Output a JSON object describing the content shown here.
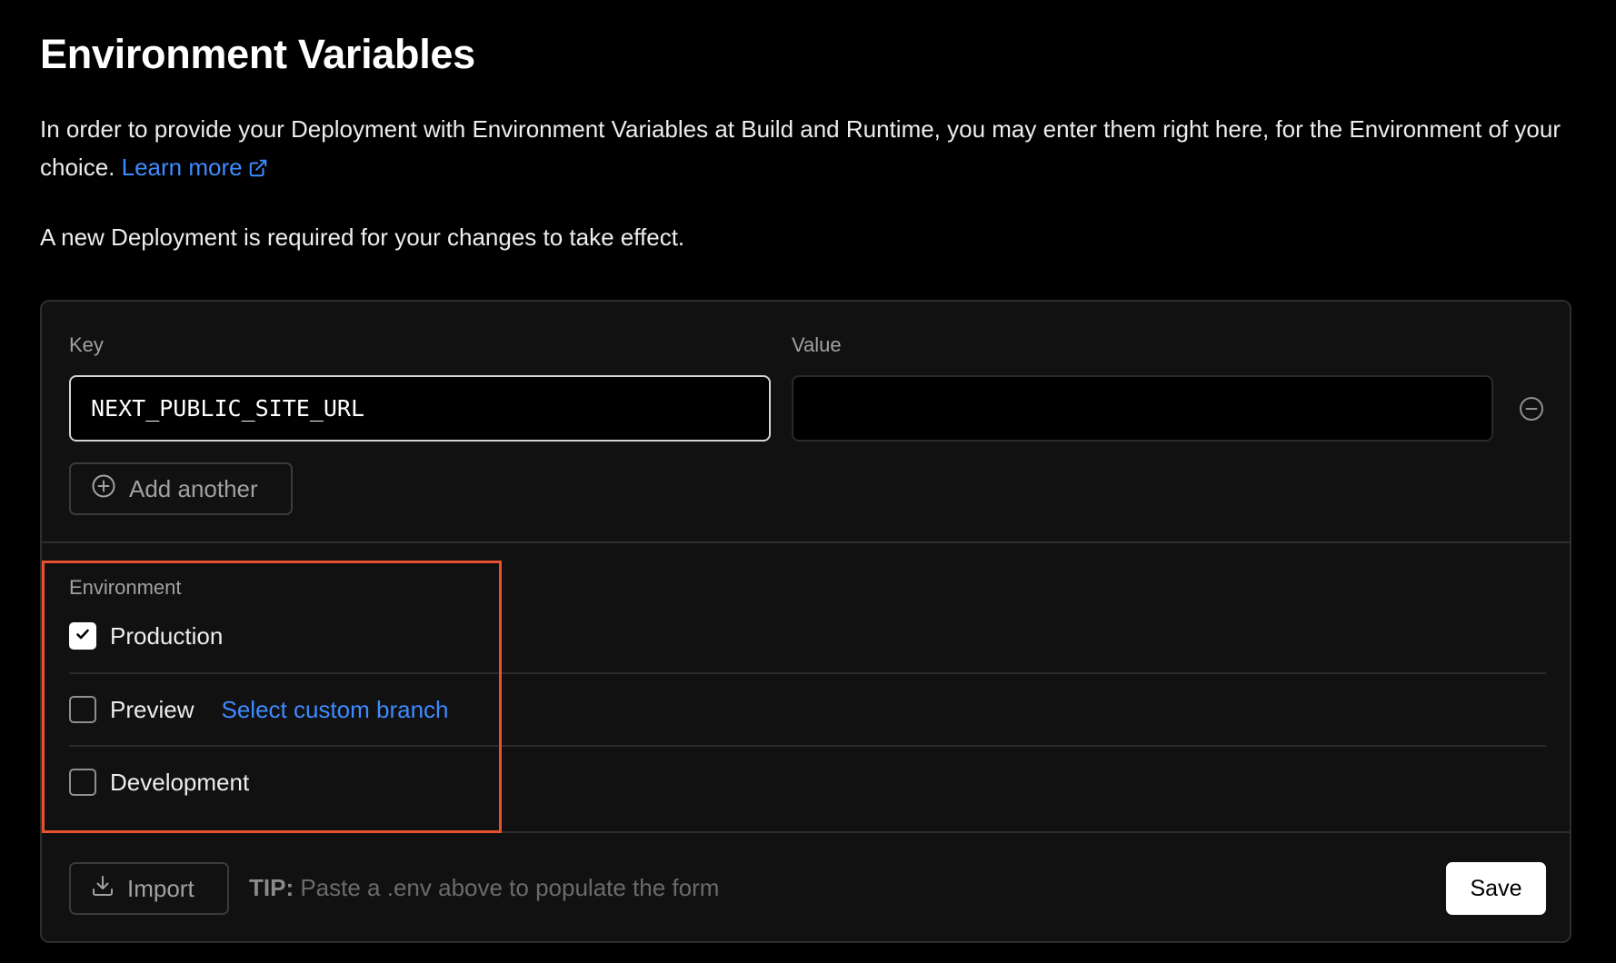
{
  "header": {
    "title": "Environment Variables",
    "description": "In order to provide your Deployment with Environment Variables at Build and Runtime, you may enter them right here, for the Environment of your choice.",
    "learn_more": "Learn more",
    "note": "A new Deployment is required for your changes to take effect."
  },
  "form": {
    "key_label": "Key",
    "value_label": "Value",
    "key_value": "NEXT_PUBLIC_SITE_URL",
    "value_value": "",
    "add_another": "Add another"
  },
  "environment": {
    "label": "Environment",
    "options": [
      {
        "label": "Production",
        "checked": true
      },
      {
        "label": "Preview",
        "checked": false,
        "link": "Select custom branch"
      },
      {
        "label": "Development",
        "checked": false
      }
    ]
  },
  "footer": {
    "import": "Import",
    "tip_prefix": "TIP:",
    "tip_text": "Paste a .env above to populate the form",
    "save": "Save"
  },
  "colors": {
    "background": "#000000",
    "card": "#111111",
    "link": "#3e8bff",
    "highlight": "#e8502e"
  }
}
